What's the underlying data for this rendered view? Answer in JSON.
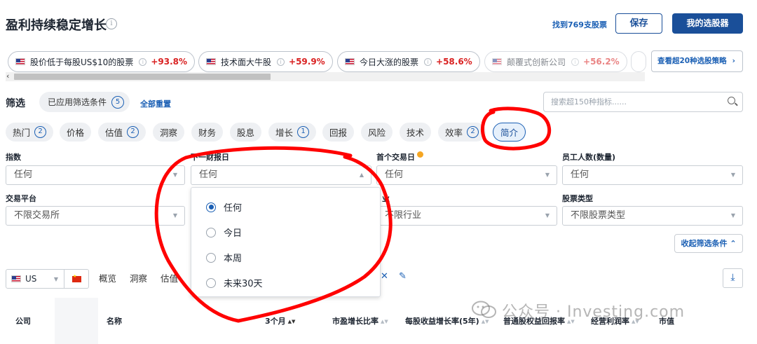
{
  "header": {
    "title": "盈利持续稳定增长",
    "info_glyph": "i",
    "found_text": "找到769支股票",
    "save_label": "保存",
    "screener_label": "我的选股器"
  },
  "strategies": [
    {
      "name": "股价低于每股US$10的股票",
      "pct": "+93.8%"
    },
    {
      "name": "技术面大牛股",
      "pct": "+59.9%"
    },
    {
      "name": "今日大涨的股票",
      "pct": "+58.6%"
    },
    {
      "name": "颠覆式创新公司",
      "pct": "+56.2%"
    }
  ],
  "more_strategies": "查看超20种选股策略",
  "more_strategies_chev": "›",
  "scroll_arrow": "‹",
  "filter": {
    "label": "筛选",
    "applied_label": "已应用筛选条件",
    "applied_count": "5",
    "reset_label": "全部重置",
    "search_placeholder": "搜索超150种指标......"
  },
  "categories": [
    {
      "label": "热门",
      "count": "2"
    },
    {
      "label": "价格",
      "count": ""
    },
    {
      "label": "估值",
      "count": "2"
    },
    {
      "label": "洞察",
      "count": ""
    },
    {
      "label": "财务",
      "count": ""
    },
    {
      "label": "股息",
      "count": ""
    },
    {
      "label": "增长",
      "count": "1"
    },
    {
      "label": "回报",
      "count": ""
    },
    {
      "label": "风险",
      "count": ""
    },
    {
      "label": "技术",
      "count": ""
    },
    {
      "label": "效率",
      "count": "2"
    },
    {
      "label": "简介",
      "count": ""
    }
  ],
  "fields": {
    "index": {
      "label": "指数",
      "value": "任何"
    },
    "next_earnings": {
      "label": "下一财报日",
      "value": "任何"
    },
    "first_trade": {
      "label": "首个交易日",
      "value": "任何"
    },
    "employees": {
      "label": "员工人数(数量)",
      "value": "任何"
    },
    "exchange": {
      "label": "交易平台",
      "value": "不限交易所"
    },
    "industry": {
      "label": "业",
      "value": "不限行业"
    },
    "stock_type": {
      "label": "股票类型",
      "value": "不限股票类型"
    }
  },
  "dropdown_options": [
    "任何",
    "今日",
    "本周",
    "未来30天"
  ],
  "dropdown_selected": "任何",
  "collapse_label": "收起筛选条件",
  "collapse_chev": "⌃",
  "market": {
    "label": "US"
  },
  "view_tabs": [
    "概览",
    "洞察",
    "估值"
  ],
  "download_glyph": "⤓",
  "table_headers": [
    "公司",
    "名称",
    "3个月",
    "市盈增长比率",
    "每股收益增长率(5年)",
    "普通股权益回报率",
    "经营利润率",
    "市值"
  ],
  "watermark": "公众号 · Investing.com",
  "glyphs": {
    "caret_down": "▼",
    "caret_up": "▲",
    "sort": "▲▼",
    "edit": "✎",
    "tool": "✕"
  },
  "colors": {
    "accent": "#1a4f99",
    "link": "#1a5fb4",
    "positive": "#d92121",
    "annotation": "#ff0000"
  }
}
